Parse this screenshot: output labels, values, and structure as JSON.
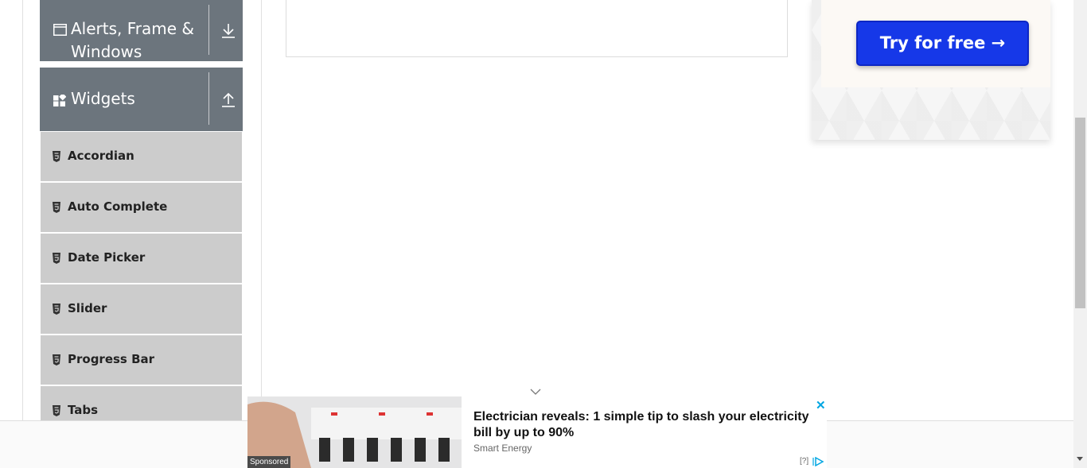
{
  "sidebar": {
    "groups": [
      {
        "label_line1": "Alerts, Frame &",
        "label_line2": "Windows",
        "icon": "window-icon",
        "toggle": "download-arrow-icon"
      },
      {
        "label": "Widgets",
        "icon": "widgets-icon",
        "toggle": "upload-arrow-icon"
      }
    ],
    "items": [
      {
        "label": "Accordian"
      },
      {
        "label": "Auto Complete"
      },
      {
        "label": "Date Picker"
      },
      {
        "label": "Slider"
      },
      {
        "label": "Progress Bar"
      },
      {
        "label": "Tabs"
      }
    ]
  },
  "ad_right": {
    "button_label": "Try for free →",
    "colors": {
      "button": "#1638e8"
    }
  },
  "bottom_ad": {
    "headline": "Electrician reveals: 1 simple tip to slash your electricity bill by up to 90%",
    "source": "Smart Energy",
    "sponsored_label": "Sponsored",
    "help_label": "[?]",
    "close_icon": "close-icon",
    "adchoices_icon": "adchoices-icon"
  },
  "colors": {
    "group_header": "#6c757d",
    "menu_item": "#cccccc",
    "close": "#00a6e2"
  }
}
